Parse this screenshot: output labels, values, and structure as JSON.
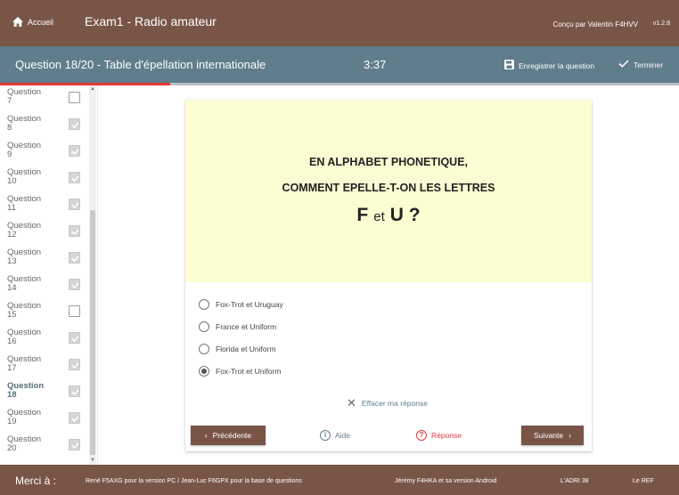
{
  "header": {
    "home_label": "Accueil",
    "app_title": "Exam1 - Radio amateur",
    "credit": "Conçu par Valentin F4HVV",
    "version": "v1.2.8"
  },
  "question_bar": {
    "title": "Question 18/20 - Table d'épellation internationale",
    "timer": "3:37",
    "save_label": "Enregistrer la question",
    "finish_label": "Terminer",
    "progress_fraction": 0.25,
    "progress_color": "#e53935"
  },
  "sidebar": {
    "items": [
      {
        "label": "Question\n7",
        "answered": false,
        "current": false
      },
      {
        "label": "Question\n8",
        "answered": true,
        "current": false
      },
      {
        "label": "Question\n9",
        "answered": true,
        "current": false
      },
      {
        "label": "Question\n10",
        "answered": true,
        "current": false
      },
      {
        "label": "Question\n11",
        "answered": true,
        "current": false
      },
      {
        "label": "Question\n12",
        "answered": true,
        "current": false
      },
      {
        "label": "Question\n13",
        "answered": true,
        "current": false
      },
      {
        "label": "Question\n14",
        "answered": true,
        "current": false
      },
      {
        "label": "Question\n15",
        "answered": false,
        "current": false
      },
      {
        "label": "Question\n16",
        "answered": true,
        "current": false
      },
      {
        "label": "Question\n17",
        "answered": true,
        "current": false
      },
      {
        "label": "Question\n18",
        "answered": true,
        "current": true
      },
      {
        "label": "Question\n19",
        "answered": true,
        "current": false
      },
      {
        "label": "Question\n20",
        "answered": true,
        "current": false
      }
    ]
  },
  "question": {
    "line1": "EN ALPHABET PHONETIQUE,",
    "line2": "COMMENT EPELLE-T-ON LES LETTRES",
    "letter1": "F",
    "connector": "et",
    "letter2": "U ?"
  },
  "options": [
    {
      "label": "Fox-Trot et Uruguay",
      "selected": false
    },
    {
      "label": "France et Uniform",
      "selected": false
    },
    {
      "label": "Florida et Uniform",
      "selected": false
    },
    {
      "label": "Fox-Trot et Uniform",
      "selected": true
    }
  ],
  "actions": {
    "clear_label": "Effacer ma réponse",
    "prev_label": "Précédente",
    "help_label": "Aide",
    "answer_label": "Réponse",
    "next_label": "Suivante"
  },
  "footer": {
    "label": "Merci à :",
    "credit1": "René F5AXG pour la version PC / Jean-Luc F6GPX pour la base de questions",
    "credit2": "Jérémy F4HKA et sa version Android",
    "credit3": "L'ADRI 38",
    "credit4": "Le REF"
  },
  "colors": {
    "brand_brown": "#795548",
    "bar_slate": "#607d8b",
    "question_bg": "#fcfcd3",
    "accent_red": "#e53935"
  }
}
